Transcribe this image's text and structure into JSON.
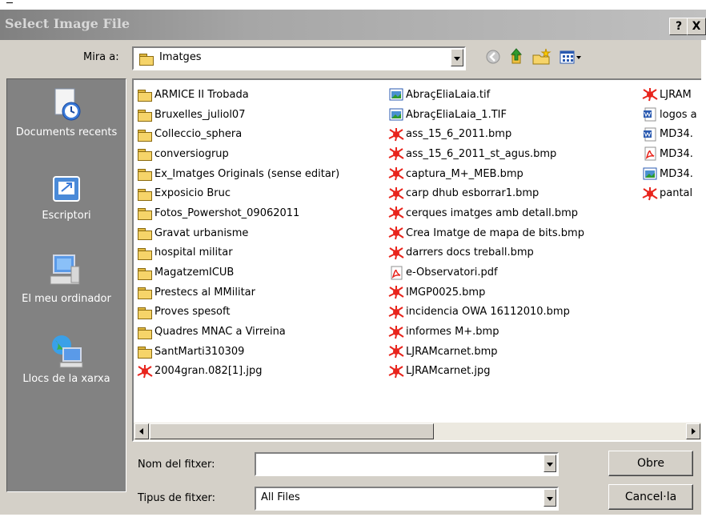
{
  "dialog": {
    "title": "Select Image File",
    "help_label": "?",
    "close_label": "X"
  },
  "lookin": {
    "label": "Mira a:",
    "value": "Imatges"
  },
  "sidebar": {
    "items": [
      {
        "label": "Documents recents",
        "icon": "recent-documents-icon"
      },
      {
        "label": "Escriptori",
        "icon": "desktop-icon"
      },
      {
        "label": "El meu ordinador",
        "icon": "my-computer-icon"
      },
      {
        "label": "Llocs de la xarxa",
        "icon": "network-places-icon"
      }
    ]
  },
  "files": {
    "col1": [
      {
        "name": "ARMICE II Trobada",
        "type": "folder"
      },
      {
        "name": "Bruxelles_juliol07",
        "type": "folder"
      },
      {
        "name": "Colleccio_sphera",
        "type": "folder"
      },
      {
        "name": "conversiogrup",
        "type": "folder"
      },
      {
        "name": "Ex_Imatges Originals (sense editar)",
        "type": "folder"
      },
      {
        "name": "Exposicio Bruc",
        "type": "folder"
      },
      {
        "name": "Fotos_Powershot_09062011",
        "type": "folder"
      },
      {
        "name": "Gravat urbanisme",
        "type": "folder"
      },
      {
        "name": "hospital militar",
        "type": "folder"
      },
      {
        "name": "MagatzemICUB",
        "type": "folder"
      },
      {
        "name": "Prestecs al MMilitar",
        "type": "folder"
      },
      {
        "name": "Proves spesoft",
        "type": "folder"
      },
      {
        "name": "Quadres MNAC a Virreina",
        "type": "folder"
      },
      {
        "name": "SantMarti310309",
        "type": "folder"
      },
      {
        "name": "2004gran.082[1].jpg",
        "type": "image"
      }
    ],
    "col2": [
      {
        "name": "AbraçEliaLaia.tif",
        "type": "tif"
      },
      {
        "name": "AbraçEliaLaia_1.TIF",
        "type": "tif"
      },
      {
        "name": "ass_15_6_2011.bmp",
        "type": "image"
      },
      {
        "name": "ass_15_6_2011_st_agus.bmp",
        "type": "image"
      },
      {
        "name": "captura_M+_MEB.bmp",
        "type": "image"
      },
      {
        "name": "carp dhub esborrar1.bmp",
        "type": "image"
      },
      {
        "name": "cerques imatges amb detall.bmp",
        "type": "image"
      },
      {
        "name": "Crea Imatge de mapa de bits.bmp",
        "type": "image"
      },
      {
        "name": "darrers docs treball.bmp",
        "type": "image"
      },
      {
        "name": "e-Observatori.pdf",
        "type": "pdf"
      },
      {
        "name": "IMGP0025.bmp",
        "type": "image"
      },
      {
        "name": "incidencia OWA 16112010.bmp",
        "type": "image"
      },
      {
        "name": "informes M+.bmp",
        "type": "image"
      },
      {
        "name": "LJRAMcarnet.bmp",
        "type": "image"
      },
      {
        "name": "LJRAMcarnet.jpg",
        "type": "image"
      }
    ],
    "col3": [
      {
        "name": "LJRAM",
        "type": "image"
      },
      {
        "name": "logos a",
        "type": "doc"
      },
      {
        "name": "MD34.",
        "type": "doc"
      },
      {
        "name": "MD34.",
        "type": "pdf"
      },
      {
        "name": "MD34.",
        "type": "tif"
      },
      {
        "name": "pantal",
        "type": "image"
      }
    ]
  },
  "filename": {
    "label": "Nom del fitxer:",
    "value": ""
  },
  "filetype": {
    "label": "Tipus de fitxer:",
    "value": "All Files"
  },
  "buttons": {
    "open": "Obre",
    "cancel": "Cancel·la"
  },
  "colors": {
    "folder": "#f6d469",
    "image_icon": "#e8241c",
    "title_text": "#d8d8d8",
    "sidebar_bg": "#828282"
  }
}
